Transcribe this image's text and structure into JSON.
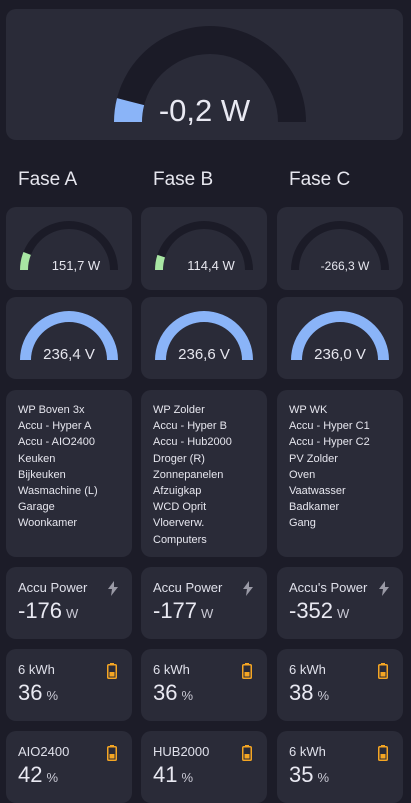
{
  "total": {
    "value": "-0,2 W",
    "fraction": 0.08
  },
  "phases": [
    {
      "header": "Fase A",
      "power": {
        "value": "151,7 W",
        "fraction": 0.12
      },
      "voltage": {
        "value": "236,4 V",
        "fraction": 1.0
      },
      "devices": [
        "WP Boven 3x",
        "Accu - Hyper A",
        "Accu - AIO2400",
        "Keuken",
        "Bijkeuken",
        "Wasmachine (L)",
        "Garage",
        "Woonkamer"
      ],
      "accu_power": {
        "title": "Accu Power",
        "value": "-176",
        "unit": "W"
      },
      "battery1": {
        "title": "6 kWh",
        "value": "36",
        "unit": "%"
      },
      "battery2": {
        "title": "AIO2400",
        "value": "42",
        "unit": "%"
      }
    },
    {
      "header": "Fase B",
      "power": {
        "value": "114,4 W",
        "fraction": 0.1
      },
      "voltage": {
        "value": "236,6 V",
        "fraction": 1.0
      },
      "devices": [
        "WP Zolder",
        "Accu - Hyper B",
        "Accu - Hub2000",
        "Droger (R)",
        "Zonnepanelen",
        "Afzuigkap",
        "WCD Oprit",
        "Vloerverw.",
        "Computers"
      ],
      "accu_power": {
        "title": "Accu Power",
        "value": "-177",
        "unit": "W"
      },
      "battery1": {
        "title": "6 kWh",
        "value": "36",
        "unit": "%"
      },
      "battery2": {
        "title": "HUB2000",
        "value": "41",
        "unit": "%"
      }
    },
    {
      "header": "Fase C",
      "power": {
        "value": "-266,3 W",
        "fraction": 0.0
      },
      "voltage": {
        "value": "236,0 V",
        "fraction": 1.0
      },
      "devices": [
        "WP WK",
        "Accu - Hyper C1",
        "Accu - Hyper C2",
        "PV Zolder",
        "Oven",
        "Vaatwasser",
        "Badkamer",
        "Gang"
      ],
      "accu_power": {
        "title": "Accu's Power",
        "value": "-352",
        "unit": "W"
      },
      "battery1": {
        "title": "6 kWh",
        "value": "38",
        "unit": "%"
      },
      "battery2": {
        "title": "6 kWh",
        "value": "35",
        "unit": "%"
      }
    }
  ],
  "colors": {
    "track": "#1b1b27",
    "blue": "#8ab4f8",
    "green": "#a8e6a3",
    "orange": "#f5a623",
    "card": "#2a2b38"
  },
  "icons": {
    "power": "lightning-bolt-icon",
    "battery": "battery-icon"
  }
}
